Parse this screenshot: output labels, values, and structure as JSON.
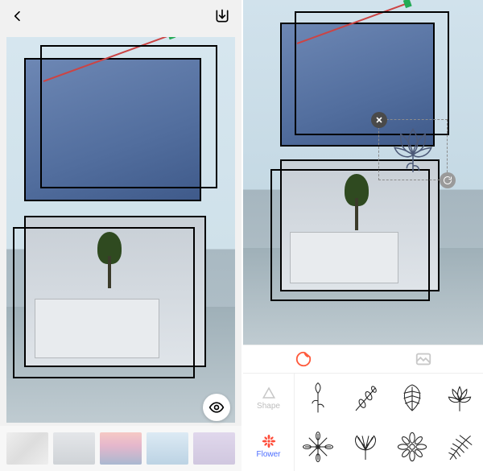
{
  "left": {
    "canvas": {
      "frames": [
        {
          "name": "frame-top",
          "content": "blue-sky-crane"
        },
        {
          "name": "frame-top-offset",
          "content": "outline-only"
        },
        {
          "name": "frame-bottom",
          "content": "building-tree"
        },
        {
          "name": "frame-bottom-offset",
          "content": "outline-only"
        }
      ]
    },
    "thumbnails": [
      {
        "name": "texture-marble"
      },
      {
        "name": "texture-plain"
      },
      {
        "name": "texture-sunset"
      },
      {
        "name": "texture-sky"
      },
      {
        "name": "texture-lilac"
      }
    ]
  },
  "right": {
    "canvas": {
      "frames": [
        {
          "name": "frame-top",
          "content": "blue-sky-crane"
        },
        {
          "name": "frame-top-offset",
          "content": "outline-only"
        },
        {
          "name": "frame-bottom",
          "content": "building-tree"
        },
        {
          "name": "frame-bottom-offset",
          "content": "outline-only"
        }
      ],
      "selected_sticker": {
        "name": "lotus-flower-sticker"
      }
    },
    "tabs": {
      "active": "sticker",
      "items": [
        {
          "name": "sticker-tab",
          "active": true
        },
        {
          "name": "image-tab",
          "active": false
        }
      ]
    },
    "categories": {
      "active": "Flower",
      "items": [
        {
          "key": "shape",
          "label": "Shape"
        },
        {
          "key": "flower",
          "label": "Flower"
        }
      ]
    },
    "stickers": [
      {
        "name": "flower-tall-stem"
      },
      {
        "name": "flower-branch"
      },
      {
        "name": "leaf-monstera"
      },
      {
        "name": "flower-lotus"
      },
      {
        "name": "leaf-radial"
      },
      {
        "name": "leaf-ginkgo-fan"
      },
      {
        "name": "flower-dahlia"
      },
      {
        "name": "leaf-palm"
      }
    ]
  },
  "colors": {
    "accent": "#ff5a3c",
    "selected_category": "#4c6dff"
  }
}
